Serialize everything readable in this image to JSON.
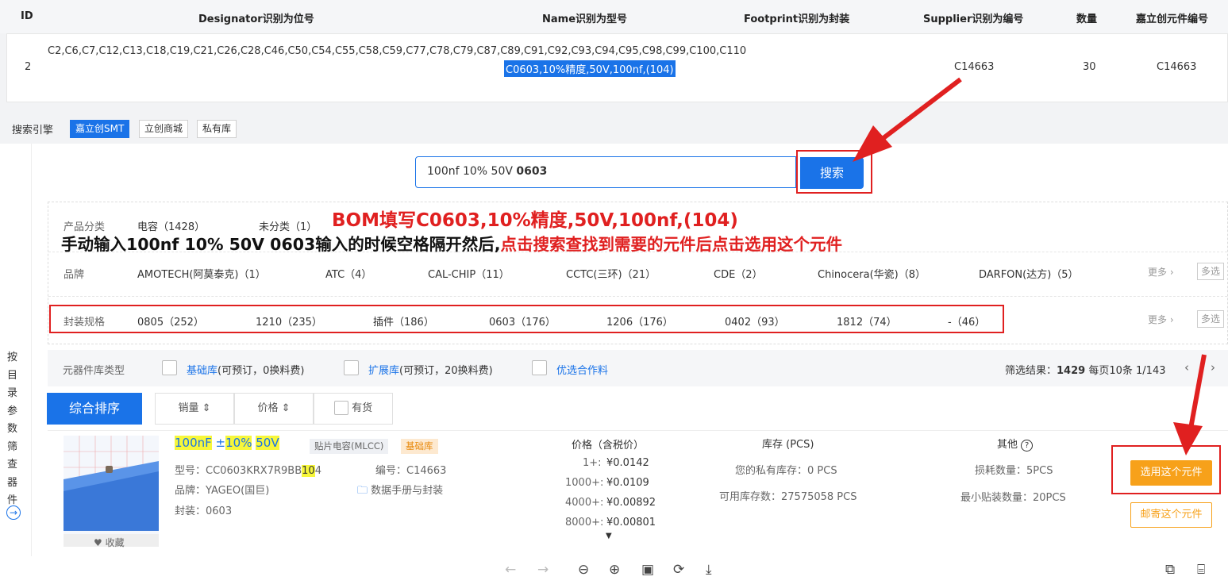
{
  "bom_table": {
    "headers": {
      "id": "ID",
      "designator": "Designator识别为位号",
      "name": "Name识别为型号",
      "footprint": "Footprint识别为封装",
      "supplier": "Supplier识别为编号",
      "qty": "数量",
      "part_no": "嘉立创元件编号"
    },
    "row": {
      "id": "2",
      "designator": "C2,C6,C7,C12,C13,C18,C19,C21,C26,C28,C46,C50,C54,C55,C58,C59,C77,C78,C79,C87,C89,C91,C92,C93,C94,C95,C98,C99,C100,C110",
      "name": "C0603,10%精度,50V,100nf,(104)",
      "supplier": "C14663",
      "qty": "30",
      "part_no": "C14663"
    }
  },
  "engines": {
    "label": "搜索引擎",
    "options": [
      "嘉立创SMT",
      "立创商城",
      "私有库"
    ],
    "active": "嘉立创SMT"
  },
  "search": {
    "value_plain": "100nf 10% 50V ",
    "value_bold": "0603",
    "button": "搜索"
  },
  "annotations": {
    "line1": "BOM填写C0603,10%精度,50V,100nf,(104)",
    "line2_black": "手动输入100nf  10%  50V 0603输入的时候空格隔开然后,",
    "line2_red": "点击搜索查找到需要的元件后点击选用这个元件"
  },
  "filters": {
    "category": {
      "label": "产品分类",
      "items": [
        "电容（1428）",
        "未分类（1）"
      ]
    },
    "brand": {
      "label": "品牌",
      "items": [
        "AMOTECH(阿莫泰克)（1）",
        "ATC（4）",
        "CAL-CHIP（11）",
        "CCTC(三环)（21）",
        "CDE（2）",
        "Chinocera(华瓷)（8）",
        "DARFON(达方)（5）"
      ],
      "more": "更多",
      "multi": "多选"
    },
    "package": {
      "label": "封装规格",
      "items": [
        "0805（252）",
        "1210（235）",
        "插件（186）",
        "0603（176）",
        "1206（176）",
        "0402（93）",
        "1812（74）",
        "-（46）"
      ],
      "more": "更多",
      "multi": "多选"
    }
  },
  "library": {
    "label": "元器件库类型",
    "basic_link": "基础库",
    "basic_note": "(可预订，0换料费)",
    "ext_link": "扩展库",
    "ext_note": "(可预订，20换料费)",
    "preferred": "优选合作料",
    "result_label": "筛选结果：",
    "result_count": "1429",
    "per_page": "每页10条",
    "page": "1/143"
  },
  "sort": {
    "default": "综合排序",
    "sales": "销量",
    "price": "价格",
    "stock": "有货"
  },
  "sidebar": {
    "text": [
      "按",
      "目",
      "录",
      "参",
      "数",
      "筛",
      "查",
      "器",
      "件"
    ]
  },
  "product": {
    "title_parts": [
      "100nF",
      "±",
      "10%",
      "50V"
    ],
    "tag_type": "贴片电容(MLCC)",
    "tag_lib": "基础库",
    "model_label": "型号：",
    "model_pre": "CC0603KRX7R9BB",
    "model_hl": "10",
    "model_post": "4",
    "code_label": "编号：",
    "code": "C14663",
    "brand_label": "品牌：",
    "brand": "YAGEO(国巨)",
    "datasheet": "数据手册与封装",
    "package_label": "封装：",
    "package": "0603",
    "favorite": "收藏",
    "price_header": "价格（含税价）",
    "prices": [
      {
        "qty": "1+:",
        "price": "¥0.0142"
      },
      {
        "qty": "1000+:",
        "price": "¥0.0109"
      },
      {
        "qty": "4000+:",
        "price": "¥0.00892"
      },
      {
        "qty": "8000+:",
        "price": "¥0.00801"
      }
    ],
    "stock_header": "库存 (PCS)",
    "private_stock": "您的私有库存：0 PCS",
    "available_stock": "可用库存数：27575058 PCS",
    "other_header": "其他",
    "loss_qty": "损耗数量：5PCS",
    "min_qty": "最小贴装数量：20PCS",
    "pick_button": "选用这个元件",
    "mail_button": "邮寄这个元件"
  },
  "colors": {
    "primary": "#1a73e8",
    "annotation_red": "#e02020",
    "orange": "#f7a11a",
    "highlight_yellow": "#f7f73a"
  }
}
